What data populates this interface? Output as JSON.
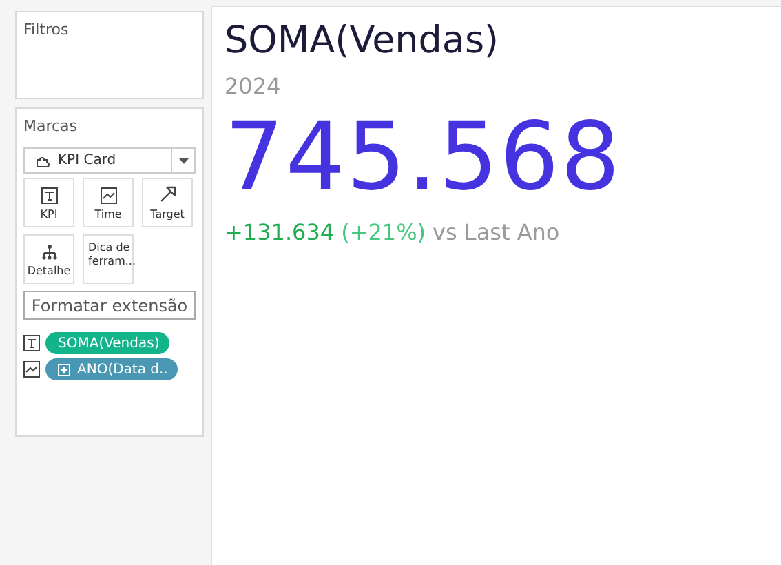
{
  "filters": {
    "title": "Filtros"
  },
  "marks": {
    "title": "Marcas",
    "mark_type": "KPI Card",
    "buttons": [
      {
        "label": "KPI",
        "kind": "text"
      },
      {
        "label": "Time",
        "kind": "line"
      },
      {
        "label": "Target",
        "kind": "arrow"
      },
      {
        "label": "Detalhe",
        "kind": "tree"
      },
      {
        "label": "Dica de ferram...",
        "kind": "none"
      }
    ],
    "format_button": "Formatar extensão",
    "pills": [
      {
        "label": "SOMA(Vendas)",
        "kind": "text",
        "color": "#13b48a",
        "expandable": false
      },
      {
        "label": "ANO(Data d..",
        "kind": "line",
        "color": "#4a97b3",
        "expandable": true
      }
    ]
  },
  "kpi": {
    "title": "SOMA(Vendas)",
    "subtitle": "2024",
    "value": "745.568",
    "delta": "+131.634",
    "percent": "(+21%)",
    "comparison": "vs Last Ano"
  }
}
